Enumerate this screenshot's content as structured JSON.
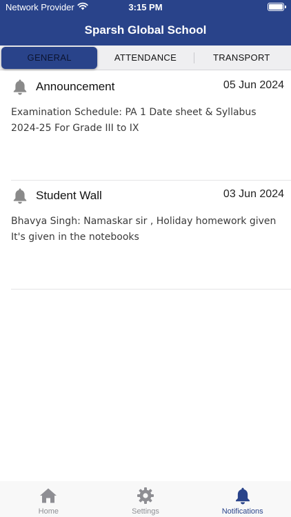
{
  "status_bar": {
    "provider": "Network Provider",
    "time": "3:15 PM",
    "wifi_icon": "wifi-icon",
    "battery_icon": "battery-icon"
  },
  "header": {
    "title": "Sparsh Global School"
  },
  "tabs": [
    {
      "label": "GENERAL",
      "active": true
    },
    {
      "label": "ATTENDANCE",
      "active": false
    },
    {
      "label": "TRANSPORT",
      "active": false
    }
  ],
  "notifications": [
    {
      "icon": "bell-icon",
      "title": "Announcement",
      "date": "05 Jun 2024",
      "body": "Examination Schedule: PA 1 Date sheet & Syllabus 2024-25 For Grade III to IX"
    },
    {
      "icon": "bell-icon",
      "title": "Student Wall",
      "date": "03 Jun 2024",
      "body": "Bhavya Singh: Namaskar sir , Holiday homework given It's given in the notebooks"
    }
  ],
  "bottom_nav": [
    {
      "label": "Home",
      "icon": "home-icon",
      "active": false
    },
    {
      "label": "Settings",
      "icon": "gear-icon",
      "active": false
    },
    {
      "label": "Notifications",
      "icon": "bell-icon",
      "active": true
    }
  ],
  "colors": {
    "brand": "#29438a",
    "inactive_icon": "#8e8e93",
    "bell_gray": "#8a8a8a"
  }
}
